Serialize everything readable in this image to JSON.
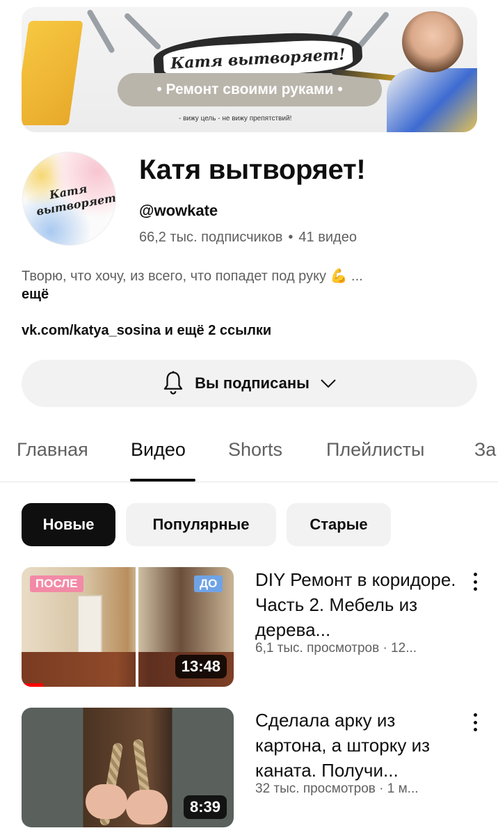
{
  "banner": {
    "title": "Катя вытворяет!",
    "subtitle": "• Ремонт своими руками •",
    "motto": "- вижу цель - не вижу препятствий!"
  },
  "channel": {
    "avatar_text": "Катя вытворяет!",
    "name": "Катя вытворяет!",
    "handle": "@wowkate",
    "subscribers": "66,2 тыс. подписчиков",
    "separator": "•",
    "video_count": "41 видео",
    "description": "Творю, что хочу, из всего, что попадет под руку 💪 ...",
    "description_more": "ещё",
    "links": "vk.com/katya_sosina и ещё 2 ссылки"
  },
  "subscribe_button": {
    "label": "Вы подписаны",
    "bell_icon": "bell-icon",
    "chevron_icon": "chevron-down-icon"
  },
  "tabs": [
    {
      "label": "Главная",
      "active": false
    },
    {
      "label": "Видео",
      "active": true
    },
    {
      "label": "Shorts",
      "active": false
    },
    {
      "label": "Плейлисты",
      "active": false
    },
    {
      "label": "За",
      "active": false
    }
  ],
  "chips": [
    {
      "label": "Новые",
      "active": true
    },
    {
      "label": "Популярные",
      "active": false
    },
    {
      "label": "Старые",
      "active": false
    }
  ],
  "videos": [
    {
      "title": "DIY Ремонт в коридоре. Часть 2. Мебель из дерева...",
      "meta": "6,1 тыс. просмотров · 12...",
      "duration": "13:48",
      "badge_after": "ПОСЛЕ",
      "badge_before": "ДО",
      "watched_fraction": 0.1
    },
    {
      "title": "Сделала арку из картона, а шторку из каната. Получи...",
      "meta": "32 тыс. просмотров · 1 м...",
      "duration": "8:39"
    }
  ],
  "colors": {
    "text_primary": "#0f0f0f",
    "text_secondary": "#606060",
    "chip_bg": "#f2f2f2",
    "badge_after": "#f28aa6",
    "badge_before": "#6fa3e6",
    "progress": "#ff0000"
  }
}
